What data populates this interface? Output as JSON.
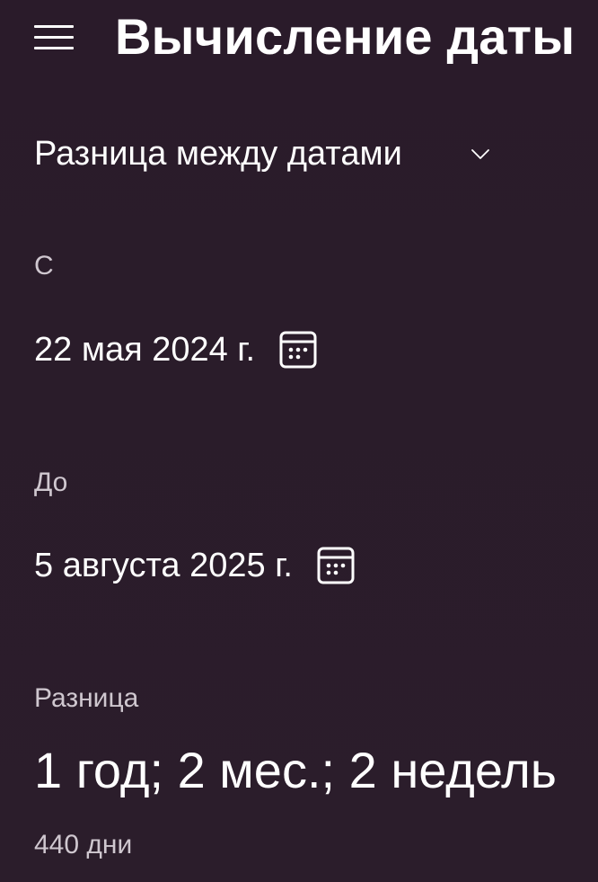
{
  "header": {
    "title": "Вычисление даты",
    "menu_icon": "hamburger-menu-icon"
  },
  "mode": {
    "label": "Разница между датами",
    "icon": "chevron-down-icon"
  },
  "from": {
    "label": "С",
    "date": "22 мая 2024 г.",
    "icon": "calendar-icon"
  },
  "to": {
    "label": "До",
    "date": "5 августа 2025 г.",
    "icon": "calendar-icon"
  },
  "difference": {
    "label": "Разница",
    "value": "1 год; 2 мес.; 2 недель",
    "days": "440 дни"
  },
  "colors": {
    "background": "#2a1c2a",
    "text_primary": "#ffffff",
    "text_secondary": "#cfc7cf"
  }
}
